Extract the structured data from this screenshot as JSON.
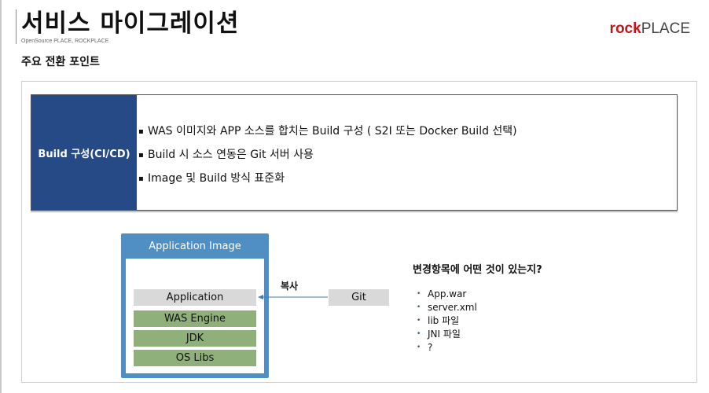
{
  "header": {
    "title": "서비스 마이그레이션",
    "subtitle": "OpenSource PLACE, ROCKPLACE",
    "logo_rock": "rock",
    "logo_place": "PLACE"
  },
  "section_title": "주요 전환 포인트",
  "build": {
    "label": "Build 구성(CI/CD)",
    "bullet": "▪",
    "items": [
      "WAS 이미지와 APP 소스를 합치는 Build 구성 ( S2I 또는 Docker Build 선택)",
      "Build 시 소스 연동은 Git 서버 사용",
      "Image 및 Build 방식 표준화"
    ]
  },
  "diagram": {
    "image_title": "Application Image",
    "layers": [
      "Application",
      "WAS Engine",
      "JDK",
      "OS Libs"
    ],
    "git": "Git",
    "copy_label": "복사"
  },
  "changes": {
    "title": "변경항목에 어떤 것이 있는지?",
    "bullet": "•",
    "items": [
      "App.war",
      "server.xml",
      "lib 파일",
      "JNI 파일",
      "?"
    ]
  },
  "colors": {
    "build_label_bg": "#254a86",
    "image_bg": "#4f8fc4",
    "layer_gray": "#d9d9d9",
    "layer_green": "#8fb07a",
    "logo_red": "#c0161c",
    "arrow": "#4a78b5"
  }
}
